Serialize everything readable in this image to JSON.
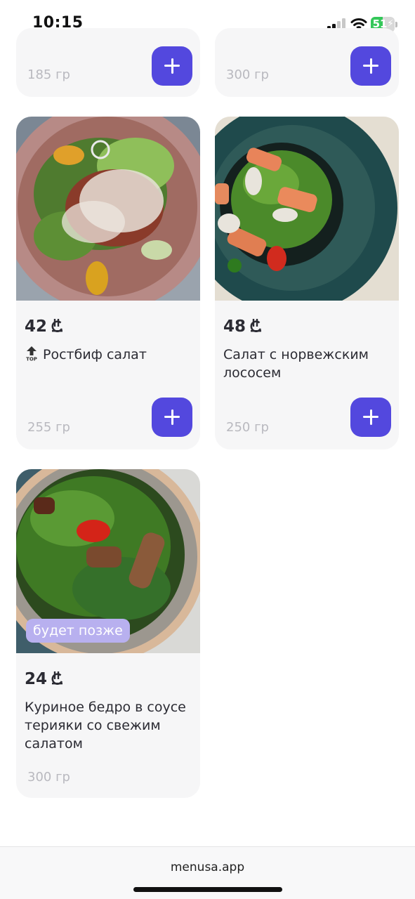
{
  "status_bar": {
    "time": "10:15",
    "battery_percent": "51",
    "battery_level": 0.51,
    "battery_color": "#34c759",
    "icons": [
      "signal-icon",
      "wifi-icon",
      "battery-icon"
    ]
  },
  "accent_color": "#5348de",
  "currency_icon": "lari-icon",
  "menu_items": [
    {
      "weight": "185 гр",
      "add_icon": "plus-icon"
    },
    {
      "weight": "300 гр",
      "add_icon": "plus-icon"
    },
    {
      "price": "42",
      "name": "Ростбиф салат",
      "badge_icon": "top-arrow-icon",
      "weight": "255 гр",
      "add_icon": "plus-icon"
    },
    {
      "price": "48",
      "name": "Салат с норвежским лососем",
      "weight": "250 гр",
      "add_icon": "plus-icon"
    },
    {
      "price": "24",
      "name": "Куриное бедро в соусе терияки со свежим салатом",
      "availability_label": "будет позже",
      "weight": "300 гр"
    }
  ],
  "footer": {
    "url": "menusa.app"
  }
}
